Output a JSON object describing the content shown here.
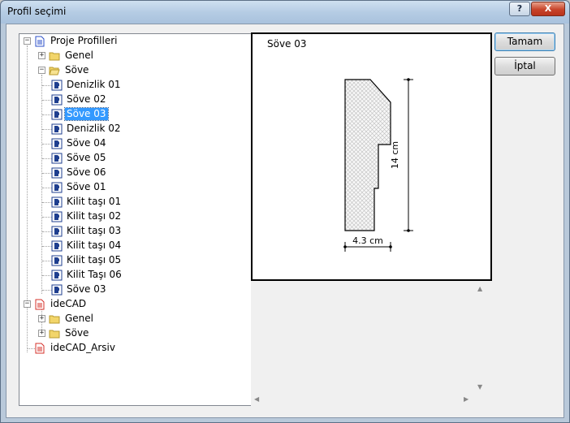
{
  "window": {
    "title": "Profil seçimi",
    "help_label": "?",
    "close_label": "X"
  },
  "tree": {
    "root_project": "Proje Profilleri",
    "genel_1": "Genel",
    "sove_1": "Söve",
    "items": [
      "Denizlik 01",
      "Söve 02",
      "Söve 03",
      "Denizlik 02",
      "Söve 04",
      "Söve 05",
      "Söve 06",
      "Söve 01",
      "Kilit taşı 01",
      "Kilit taşı 02",
      "Kilit taşı 03",
      "Kilit taşı 04",
      "Kilit taşı 05",
      "Kilit Taşı 06",
      "Söve 03"
    ],
    "selected_index": 2,
    "root_idecad": "ideCAD",
    "genel_2": "Genel",
    "sove_2": "Söve",
    "root_arsiv": "ideCAD_Arsiv"
  },
  "preview": {
    "title": "Söve 03",
    "height_label": "14 cm",
    "width_label": "4.3 cm"
  },
  "buttons": {
    "ok": "Tamam",
    "cancel": "İptal"
  },
  "colors": {
    "selection": "#3399ff",
    "project_icon": "#2b4fc8",
    "idecad_icon": "#d6302a",
    "folder": "#f2d56a"
  }
}
